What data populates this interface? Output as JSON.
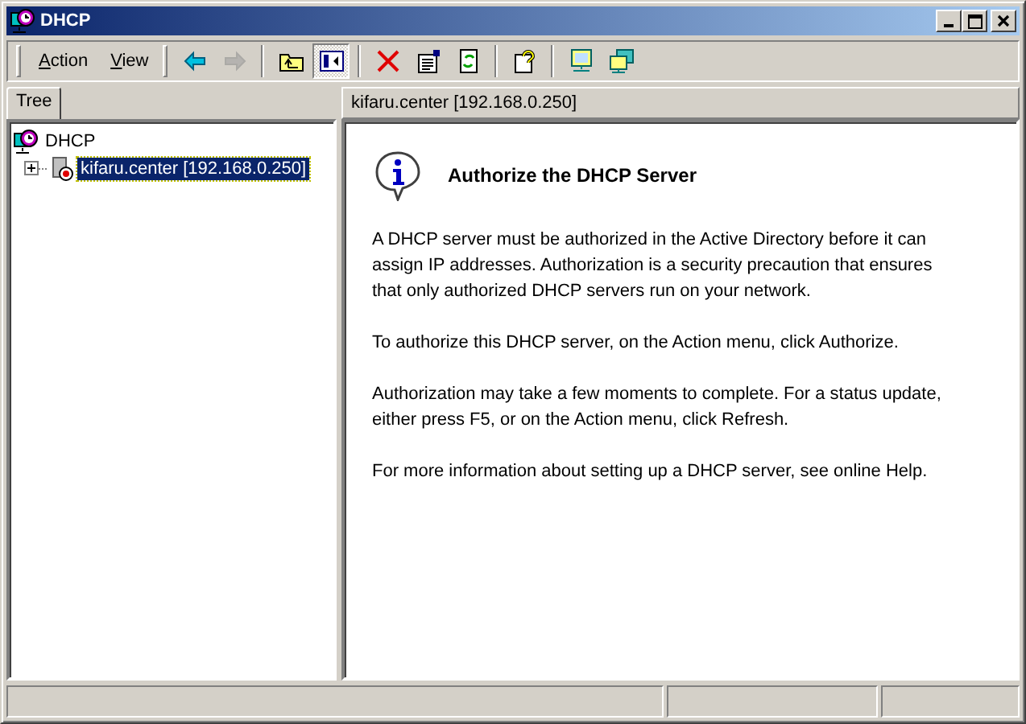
{
  "window": {
    "title": "DHCP"
  },
  "menus": [
    {
      "label": "Action"
    },
    {
      "label": "View"
    }
  ],
  "toolbar": [
    {
      "kind": "back",
      "disabled": false,
      "pressed": false
    },
    {
      "kind": "forward",
      "disabled": true,
      "pressed": false
    },
    {
      "kind": "sep"
    },
    {
      "kind": "up",
      "disabled": false,
      "pressed": false
    },
    {
      "kind": "tree",
      "disabled": false,
      "pressed": true
    },
    {
      "kind": "sep"
    },
    {
      "kind": "delete",
      "disabled": false,
      "pressed": false
    },
    {
      "kind": "properties",
      "disabled": false,
      "pressed": false
    },
    {
      "kind": "refresh",
      "disabled": false,
      "pressed": false
    },
    {
      "kind": "sep"
    },
    {
      "kind": "help",
      "disabled": false,
      "pressed": false
    },
    {
      "kind": "sep"
    },
    {
      "kind": "monitor",
      "disabled": false,
      "pressed": false
    },
    {
      "kind": "monitors",
      "disabled": false,
      "pressed": false
    }
  ],
  "tabs": [
    {
      "label": "Tree",
      "selected": true
    }
  ],
  "tree": [
    {
      "label": "DHCP",
      "kind": "dhcp",
      "selected": false,
      "children": [
        {
          "label": "kifaru.center [192.168.0.250]",
          "kind": "server",
          "selected": true,
          "expanded": false
        }
      ]
    }
  ],
  "details": {
    "header": "kifaru.center [192.168.0.250]",
    "title": "Authorize the DHCP Server",
    "paragraphs": [
      "A DHCP server must be authorized in the Active Directory before it can assign IP addresses. Authorization is a security precaution that ensures that only authorized DHCP servers run on your network.",
      "To authorize this DHCP server, on the Action menu, click Authorize.",
      "Authorization may take a few moments to complete. For a status update, either press F5, or on the Action menu, click Refresh.",
      "For more information about setting up a DHCP server, see online Help."
    ]
  }
}
